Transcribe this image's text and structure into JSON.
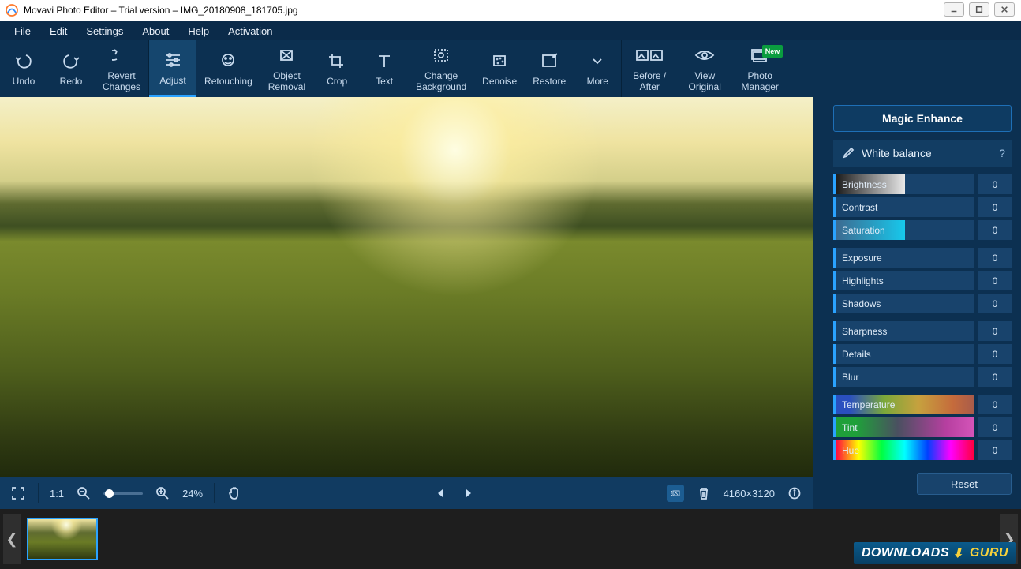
{
  "titlebar": {
    "text": "Movavi Photo Editor – Trial version – IMG_20180908_181705.jpg"
  },
  "menu": {
    "file": "File",
    "edit": "Edit",
    "settings": "Settings",
    "about": "About",
    "help": "Help",
    "activation": "Activation"
  },
  "toolbar": {
    "undo": "Undo",
    "redo": "Redo",
    "revert": "Revert\nChanges",
    "adjust": "Adjust",
    "retouch": "Retouching",
    "objrem": "Object\nRemoval",
    "crop": "Crop",
    "text": "Text",
    "changebg": "Change\nBackground",
    "denoise": "Denoise",
    "restore": "Restore",
    "more": "More",
    "beforeafter": "Before /\nAfter",
    "vieworig": "View\nOriginal",
    "photomgr": "Photo\nManager",
    "new_badge": "New"
  },
  "viewbar": {
    "oneToOne": "1:1",
    "zoom": "24%",
    "dims": "4160×3120"
  },
  "panel": {
    "magic": "Magic Enhance",
    "section": "White balance",
    "help": "?",
    "sliders": {
      "brightness": {
        "label": "Brightness",
        "value": "0"
      },
      "contrast": {
        "label": "Contrast",
        "value": "0"
      },
      "saturation": {
        "label": "Saturation",
        "value": "0"
      },
      "exposure": {
        "label": "Exposure",
        "value": "0"
      },
      "highlights": {
        "label": "Highlights",
        "value": "0"
      },
      "shadows": {
        "label": "Shadows",
        "value": "0"
      },
      "sharpness": {
        "label": "Sharpness",
        "value": "0"
      },
      "details": {
        "label": "Details",
        "value": "0"
      },
      "blur": {
        "label": "Blur",
        "value": "0"
      },
      "temperature": {
        "label": "Temperature",
        "value": "0"
      },
      "tint": {
        "label": "Tint",
        "value": "0"
      },
      "hue": {
        "label": "Hue",
        "value": "0"
      }
    },
    "reset": "Reset"
  },
  "watermark": {
    "a": "DOWNLOADS",
    "b": "GURU"
  }
}
